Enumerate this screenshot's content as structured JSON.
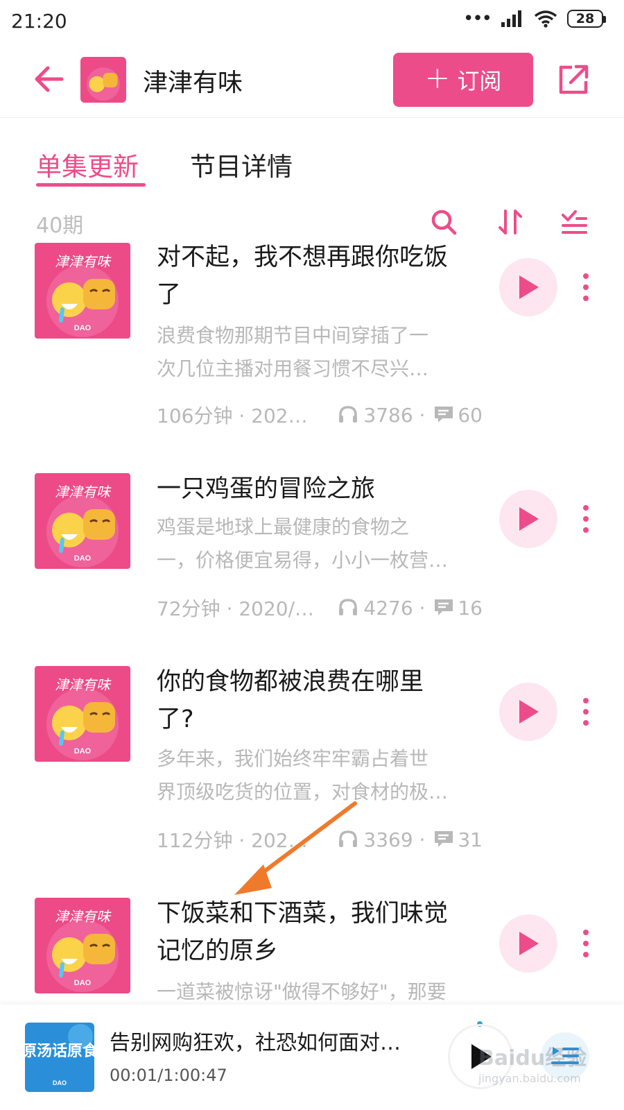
{
  "status_bar": {
    "time": "21:20",
    "battery": "28"
  },
  "header": {
    "title": "津津有味",
    "subscribe_label": "订阅",
    "subscribe_plus": "+"
  },
  "tabs": [
    {
      "label": "单集更新",
      "active": true
    },
    {
      "label": "节目详情",
      "active": false
    }
  ],
  "list_toolbar": {
    "episode_count": "40期"
  },
  "cover": {
    "title_art": "津津有味",
    "brand": "DAO"
  },
  "episodes": [
    {
      "title_line1": "对不起，我不想再跟你吃饭",
      "title_line2": "了",
      "desc_line1": "浪费食物那期节目中间穿插了一",
      "desc_line2": "次几位主播对用餐习惯不尽兴…",
      "duration_date": "106分钟 · 2020/…",
      "plays": "3786",
      "comments": "60"
    },
    {
      "title_line1": "一只鸡蛋的冒险之旅",
      "title_line2": "",
      "desc_line1": "鸡蛋是地球上最健康的食物之",
      "desc_line2": "一，价格便宜易得，小小一枚营…",
      "duration_date": "72分钟 · 2020/1…",
      "plays": "4276",
      "comments": "16"
    },
    {
      "title_line1": "你的食物都被浪费在哪里",
      "title_line2": "了?",
      "desc_line1": "多年来，我们始终牢牢霸占着世",
      "desc_line2": "界顶级吃货的位置，对食材的极…",
      "duration_date": "112分钟 · 2020/…",
      "plays": "3369",
      "comments": "31"
    },
    {
      "title_line1": "下饭菜和下酒菜，我们味觉",
      "title_line2": "记忆的原乡",
      "desc_line1": "一道菜被惊讶\"做得不够好\"，那要",
      "desc_line2": "",
      "duration_date": "",
      "plays": "",
      "comments": ""
    }
  ],
  "now_playing": {
    "title": "告别网购狂欢，社恐如何面对…",
    "time": "00:01/1:00:47",
    "cover_text": "原汤话原食",
    "cover_brand": "DAO"
  },
  "watermark": {
    "main": "Baidu经验",
    "sub": "jingyan.baidu.com"
  },
  "colors": {
    "accent": "#ed4c8a",
    "play_bg": "#fde6ef",
    "annotation_arrow": "#f07a2c"
  },
  "icons": {
    "back": "arrow-left-icon",
    "share": "share-icon",
    "search": "search-icon",
    "sort": "sort-icon",
    "filter": "list-filter-icon",
    "play": "play-icon",
    "more": "more-vertical-icon",
    "headphones": "headphones-icon",
    "comment": "comment-icon",
    "playlist": "playlist-icon"
  }
}
